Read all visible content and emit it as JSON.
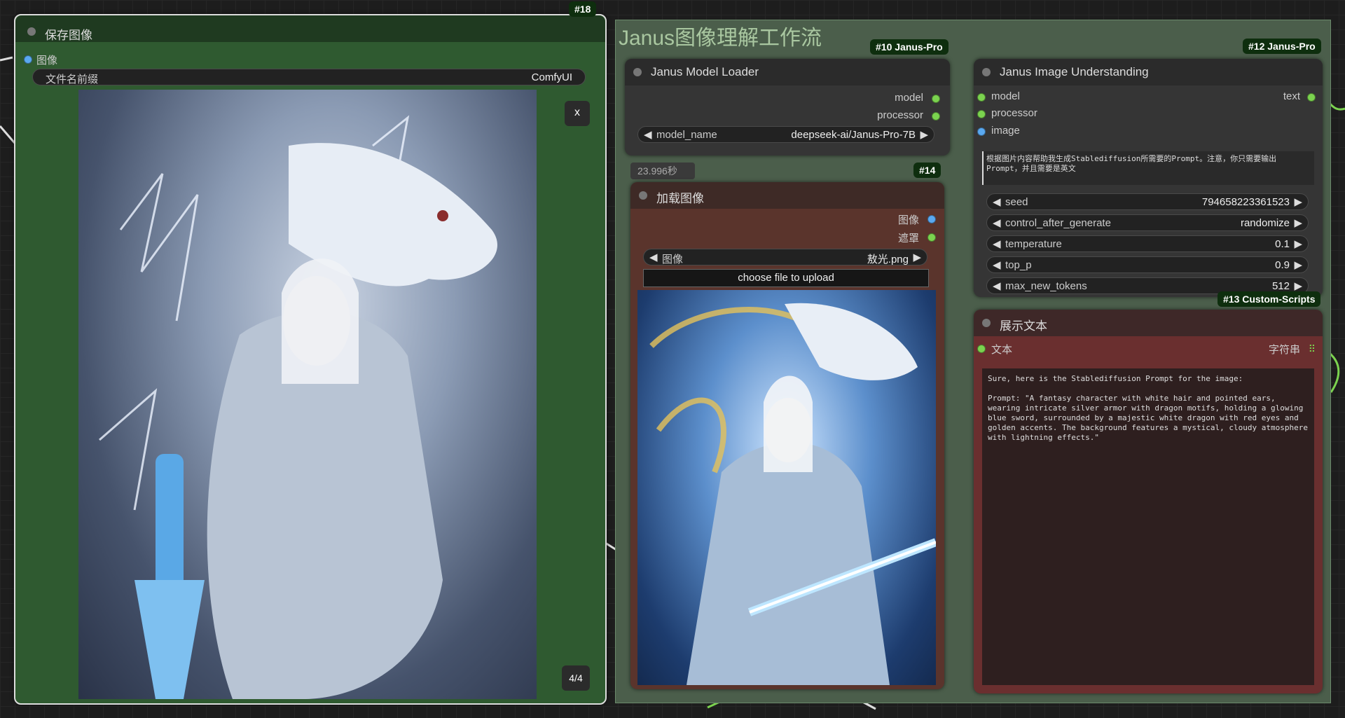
{
  "save_node": {
    "badge": "#18",
    "title": "保存图像",
    "input_label": "图像",
    "prefix_label": "文件名前缀",
    "prefix_value": "ComfyUI",
    "close_label": "x",
    "counter": "4/4"
  },
  "group": {
    "title": "Janus图像理解工作流"
  },
  "loader_node": {
    "badge": "#10 Janus-Pro",
    "title": "Janus Model Loader",
    "outputs": [
      "model",
      "processor"
    ],
    "model_name_label": "model_name",
    "model_name_value": "deepseek-ai/Janus-Pro-7B",
    "timing": "23.996秒"
  },
  "load_image_node": {
    "badge": "#14",
    "title": "加载图像",
    "outputs": [
      "图像",
      "遮罩"
    ],
    "image_label": "图像",
    "image_value": "敖光.png",
    "upload_label": "choose file to upload"
  },
  "understanding_node": {
    "badge": "#12 Janus-Pro",
    "title": "Janus Image Understanding",
    "inputs": [
      "model",
      "processor",
      "image"
    ],
    "output": "text",
    "question": "根据图片内容帮助我生成Stablediffusion所需要的Prompt。注意，你只需要输出Prompt，并且需要是英文",
    "widgets": [
      {
        "label": "seed",
        "value": "794658223361523"
      },
      {
        "label": "control_after_generate",
        "value": "randomize"
      },
      {
        "label": "temperature",
        "value": "0.1"
      },
      {
        "label": "top_p",
        "value": "0.9"
      },
      {
        "label": "max_new_tokens",
        "value": "512"
      }
    ]
  },
  "show_text_node": {
    "badge": "#13 Custom-Scripts",
    "title": "展示文本",
    "input_label": "文本",
    "output_label": "字符串",
    "output_icon": "grid-icon",
    "text": "Sure, here is the Stablediffusion Prompt for the image:\n\nPrompt: \"A fantasy character with white hair and pointed ears, wearing intricate silver armor with dragon motifs, holding a glowing blue sword, surrounded by a majestic white dragon with red eyes and golden accents. The background features a mystical, cloudy atmosphere with lightning effects.\""
  },
  "colors": {
    "group_bg": "#4b5e4b",
    "save_node_bg": "#2f5a30",
    "load_image_bg": "#5a342c",
    "show_text_bg": "#6a2f2f",
    "link_green": "#7bd34f",
    "link_blue": "#5aa9f0"
  }
}
